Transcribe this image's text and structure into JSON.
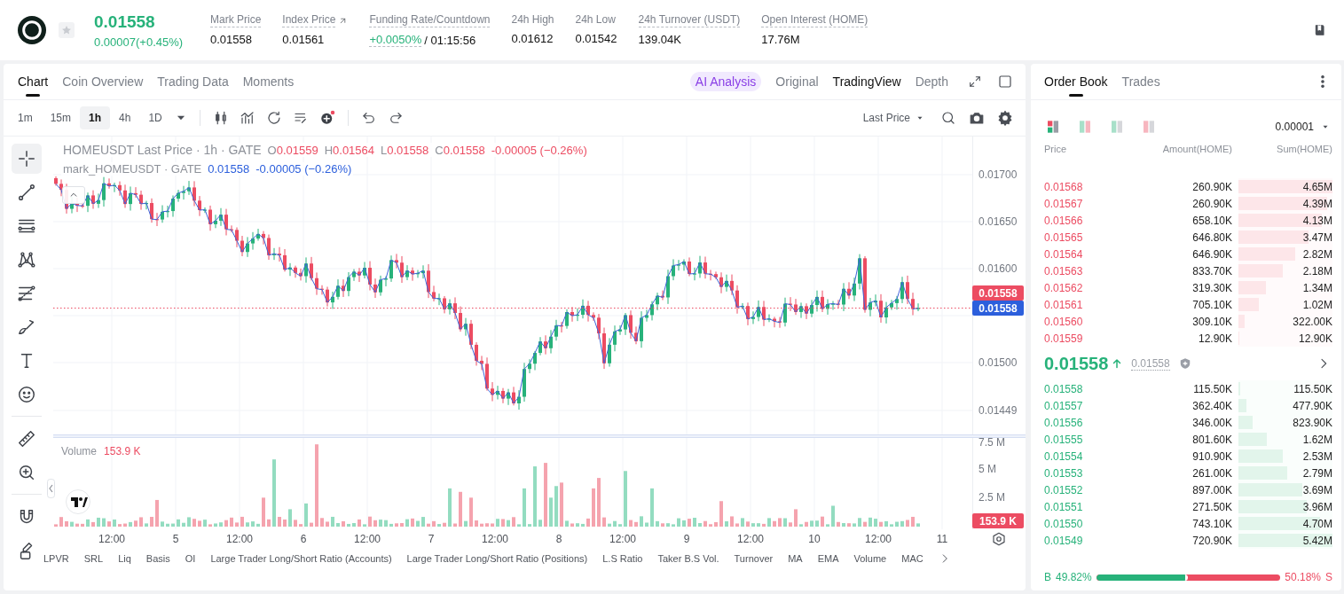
{
  "header": {
    "price": "0.01558",
    "change": "0.00007(+0.45%)",
    "stats": [
      {
        "kind": "hint",
        "label": "Mark Price",
        "value": "0.01558"
      },
      {
        "kind": "link",
        "label": "Index Price",
        "value": "0.01561"
      },
      {
        "kind": "funding",
        "label": "Funding Rate/Countdown",
        "value": "+0.0050%",
        "countdown": "/ 01:15:56"
      },
      {
        "kind": "plain",
        "label": "24h High",
        "value": "0.01612"
      },
      {
        "kind": "plain",
        "label": "24h Low",
        "value": "0.01542"
      },
      {
        "kind": "hint",
        "label": "24h Turnover (USDT)",
        "value": "139.04K"
      },
      {
        "kind": "hint",
        "label": "Open Interest (HOME)",
        "value": "17.76M"
      }
    ]
  },
  "chart_panel": {
    "tabs": [
      {
        "label": "Chart",
        "selected": true
      },
      {
        "label": "Coin Overview",
        "selected": false
      },
      {
        "label": "Trading Data",
        "selected": false
      },
      {
        "label": "Moments",
        "selected": false
      }
    ],
    "views": [
      {
        "kind": "ai",
        "label": "AI Analysis",
        "selected": false
      },
      {
        "kind": "plain",
        "label": "Original",
        "selected": false
      },
      {
        "kind": "plain",
        "label": "TradingView",
        "selected": true
      },
      {
        "kind": "plain",
        "label": "Depth",
        "selected": false
      }
    ],
    "intervals": [
      {
        "label": "1m",
        "selected": false
      },
      {
        "label": "15m",
        "selected": false
      },
      {
        "label": "1h",
        "selected": true
      },
      {
        "label": "4h",
        "selected": false
      },
      {
        "label": "1D",
        "selected": false
      }
    ],
    "price_source": "Last Price",
    "tools": [
      [
        {
          "kind": "crosshair",
          "selected": true
        },
        {
          "kind": "trend-line",
          "selected": false
        },
        {
          "kind": "channel",
          "selected": false
        },
        {
          "kind": "pattern",
          "selected": false
        },
        {
          "kind": "fibonacci",
          "selected": false
        },
        {
          "kind": "brush",
          "selected": false
        },
        {
          "kind": "text",
          "selected": false
        },
        {
          "kind": "emoji",
          "selected": false
        }
      ],
      [
        {
          "kind": "ruler",
          "selected": false
        },
        {
          "kind": "zoom",
          "selected": false
        }
      ],
      [
        {
          "kind": "magnet",
          "selected": false
        },
        {
          "kind": "lock",
          "selected": false
        }
      ]
    ],
    "legend": {
      "symbol": "HOMEUSDT Last Price · 1h · GATE",
      "ohlc": [
        {
          "key": "O",
          "value": "0.01559"
        },
        {
          "key": "H",
          "value": "0.01564"
        },
        {
          "key": "L",
          "value": "0.01558"
        },
        {
          "key": "C",
          "value": "0.01558"
        }
      ],
      "change": "-0.00005 (−0.26%)"
    },
    "mark_legend": {
      "symbol": "mark_HOMEUSDT · GATE",
      "value": "0.01558",
      "change": "-0.00005 (−0.26%)"
    },
    "price_axis": [
      "0.01700",
      "0.01650",
      "0.01600",
      "0.01500",
      "0.01449"
    ],
    "last_price_badge": "0.01558",
    "mark_price_badge": "0.01558",
    "volume": {
      "label": "Volume",
      "value": "153.9 K",
      "axis": [
        "7.5 M",
        "5 M",
        "2.5 M"
      ],
      "badge": "153.9 K"
    },
    "time_axis": [
      "12:00",
      "5",
      "12:00",
      "6",
      "12:00",
      "7",
      "12:00",
      "8",
      "12:00",
      "9",
      "12:00",
      "10",
      "12:00",
      "11"
    ],
    "indicators": [
      "LPVR",
      "SRL",
      "Liq",
      "Basis",
      "OI",
      "Large Trader Long/Short Ratio (Accounts)",
      "Large Trader Long/Short Ratio (Positions)",
      "L.S Ratio",
      "Taker B.S Vol.",
      "Turnover",
      "MA",
      "EMA",
      "Volume",
      "MAC"
    ]
  },
  "order_book": {
    "tabs": [
      {
        "label": "Order Book",
        "selected": true
      },
      {
        "label": "Trades",
        "selected": false
      }
    ],
    "view_modes": [
      {
        "kind": "both",
        "selected": true
      },
      {
        "kind": "split",
        "selected": false
      },
      {
        "kind": "bids",
        "selected": false
      },
      {
        "kind": "asks",
        "selected": false
      }
    ],
    "precision": "0.00001",
    "columns": [
      "Price",
      "Amount(HOME)",
      "Sum(HOME)"
    ],
    "asks": [
      {
        "price": "0.01568",
        "amount": "260.90K",
        "sum": "4.65M",
        "level": 1
      },
      {
        "price": "0.01567",
        "amount": "260.90K",
        "sum": "4.39M",
        "level": 0.944
      },
      {
        "price": "0.01566",
        "amount": "658.10K",
        "sum": "4.13M",
        "level": 0.888
      },
      {
        "price": "0.01565",
        "amount": "646.80K",
        "sum": "3.47M",
        "level": 0.746
      },
      {
        "price": "0.01564",
        "amount": "646.90K",
        "sum": "2.82M",
        "level": 0.606
      },
      {
        "price": "0.01563",
        "amount": "833.70K",
        "sum": "2.18M",
        "level": 0.469
      },
      {
        "price": "0.01562",
        "amount": "319.30K",
        "sum": "1.34M",
        "level": 0.288
      },
      {
        "price": "0.01561",
        "amount": "705.10K",
        "sum": "1.02M",
        "level": 0.219
      },
      {
        "price": "0.01560",
        "amount": "309.10K",
        "sum": "322.00K",
        "level": 0.069
      },
      {
        "price": "0.01559",
        "amount": "12.90K",
        "sum": "12.90K",
        "level": 0.003
      }
    ],
    "mid": {
      "price": "0.01558",
      "mark": "0.01558"
    },
    "bids": [
      {
        "price": "0.01558",
        "amount": "115.50K",
        "sum": "115.50K",
        "level": 0.021
      },
      {
        "price": "0.01557",
        "amount": "362.40K",
        "sum": "477.90K",
        "level": 0.088
      },
      {
        "price": "0.01556",
        "amount": "346.00K",
        "sum": "823.90K",
        "level": 0.152
      },
      {
        "price": "0.01555",
        "amount": "801.60K",
        "sum": "1.62M",
        "level": 0.299
      },
      {
        "price": "0.01554",
        "amount": "910.90K",
        "sum": "2.53M",
        "level": 0.467
      },
      {
        "price": "0.01553",
        "amount": "261.00K",
        "sum": "2.79M",
        "level": 0.515
      },
      {
        "price": "0.01552",
        "amount": "897.00K",
        "sum": "3.69M",
        "level": 0.681
      },
      {
        "price": "0.01551",
        "amount": "271.50K",
        "sum": "3.96M",
        "level": 0.731
      },
      {
        "price": "0.01550",
        "amount": "743.10K",
        "sum": "4.70M",
        "level": 0.867
      },
      {
        "price": "0.01549",
        "amount": "720.90K",
        "sum": "5.42M",
        "level": 1
      }
    ],
    "ratio": {
      "buy_label": "B",
      "buy": "49.82%",
      "level": 0.4982,
      "sell": "50.18%",
      "sell_label": "S"
    }
  }
}
